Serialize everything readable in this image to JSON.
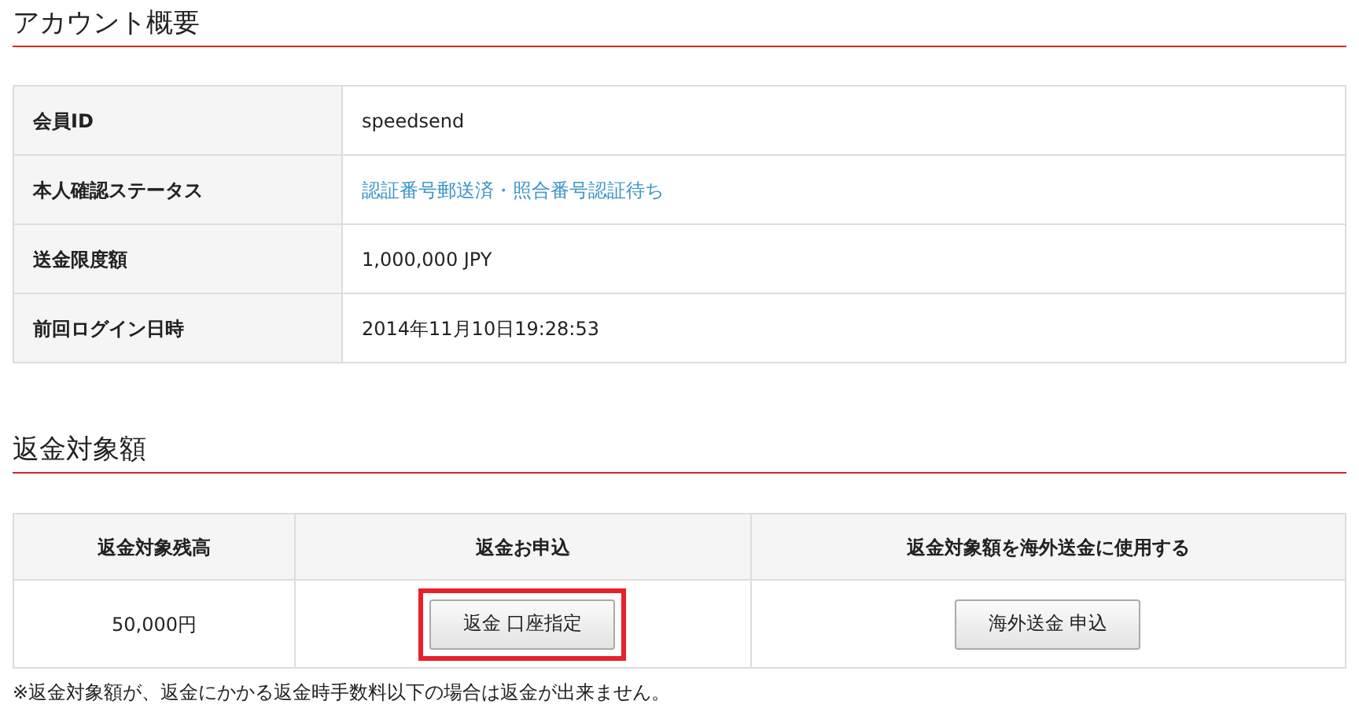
{
  "account": {
    "title": "アカウント概要",
    "rows": [
      {
        "label": "会員ID",
        "value": "speedsend",
        "kind": "text"
      },
      {
        "label": "本人確認ステータス",
        "value": "認証番号郵送済・照合番号認証待ち",
        "kind": "link"
      },
      {
        "label": "送金限度額",
        "value": "1,000,000 JPY",
        "kind": "text"
      },
      {
        "label": "前回ログイン日時",
        "value": "2014年11月10日19:28:53",
        "kind": "text"
      }
    ]
  },
  "refund": {
    "title": "返金対象額",
    "columns": [
      {
        "heading": "返金対象残高",
        "kind": "text",
        "value": "50,000円"
      },
      {
        "heading": "返金お申込",
        "kind": "button",
        "value": "返金 口座指定",
        "highlighted": true
      },
      {
        "heading": "返金対象額を海外送金に使用する",
        "kind": "button",
        "value": "海外送金 申込",
        "highlighted": false
      }
    ],
    "note": "※返金対象額が、返金にかかる返金時手数料以下の場合は返金が出来ません。"
  }
}
